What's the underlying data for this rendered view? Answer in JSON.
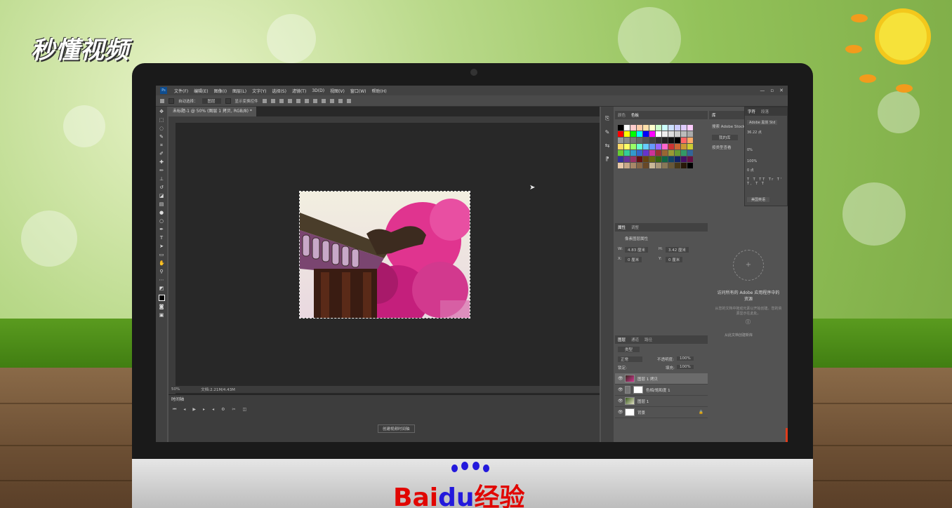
{
  "watermark": {
    "top_left": "秒懂视频",
    "bottom_brand_1": "Bai",
    "bottom_brand_2": "du",
    "bottom_brand_3": "经验"
  },
  "app": {
    "menu": [
      "文件(F)",
      "编辑(E)",
      "图像(I)",
      "图层(L)",
      "文字(Y)",
      "选择(S)",
      "滤镜(T)",
      "3D(D)",
      "视图(V)",
      "窗口(W)",
      "帮助(H)"
    ],
    "window_controls": [
      "—",
      "▫",
      "✕"
    ]
  },
  "options_bar": {
    "auto_select": "自动选择：",
    "layer_dropdown": "图层",
    "transform": "显示变换控件"
  },
  "document": {
    "tab_label": "未标题-1 @ 50% (图层 1 拷贝, RGB/8) *",
    "zoom": "50%",
    "doc_info": "文档:2.21M/4.43M"
  },
  "timeline": {
    "tab": "时间轴",
    "create_button": "创建视频时间轴"
  },
  "panels": {
    "swatches_tabs": [
      "颜色",
      "色板"
    ],
    "properties_tabs": [
      "属性",
      "调整"
    ],
    "properties_title": "像素图层属性",
    "properties": {
      "w_label": "W:",
      "w_value": "4.83 厘米",
      "h_label": "H:",
      "h_value": "3.42 厘米",
      "x_label": "X:",
      "x_value": "0 厘米",
      "y_label": "Y:",
      "y_value": "0 厘米"
    },
    "layers_tabs": [
      "图层",
      "通道",
      "路径"
    ],
    "layers_filter": "类型",
    "blend_mode": "正常",
    "opacity_label": "不透明度:",
    "opacity_value": "100%",
    "lock_label": "锁定:",
    "fill_label": "填充:",
    "fill_value": "100%",
    "layers": [
      {
        "name": "图层 1 拷贝",
        "selected": true
      },
      {
        "name": "色相/饱和度 1",
        "selected": false
      },
      {
        "name": "图层 1",
        "selected": false
      },
      {
        "name": "背景",
        "selected": false
      }
    ],
    "library_tabs": [
      "库"
    ],
    "library_search": "搜索 Adobe Stock",
    "library_name": "我的库",
    "library_view": "按类型查看",
    "library_message": "访问所有的 Adobe 应用程序中的资源",
    "library_hint": "从您的文档中拖动元素以开始创建。您的资源显示在此处。",
    "library_link": "从此文档创建新库",
    "character_tabs": [
      "字符",
      "段落"
    ],
    "character": {
      "font": "Adobe 黑体 Std",
      "size": "36.22 点",
      "tracking": "0%",
      "scale": "100%",
      "baseline": "0 点",
      "language": "美国英语"
    }
  },
  "colors": {
    "screen_bg": "#535353",
    "doc_bg": "#282828",
    "panel_tab": "#424242"
  }
}
